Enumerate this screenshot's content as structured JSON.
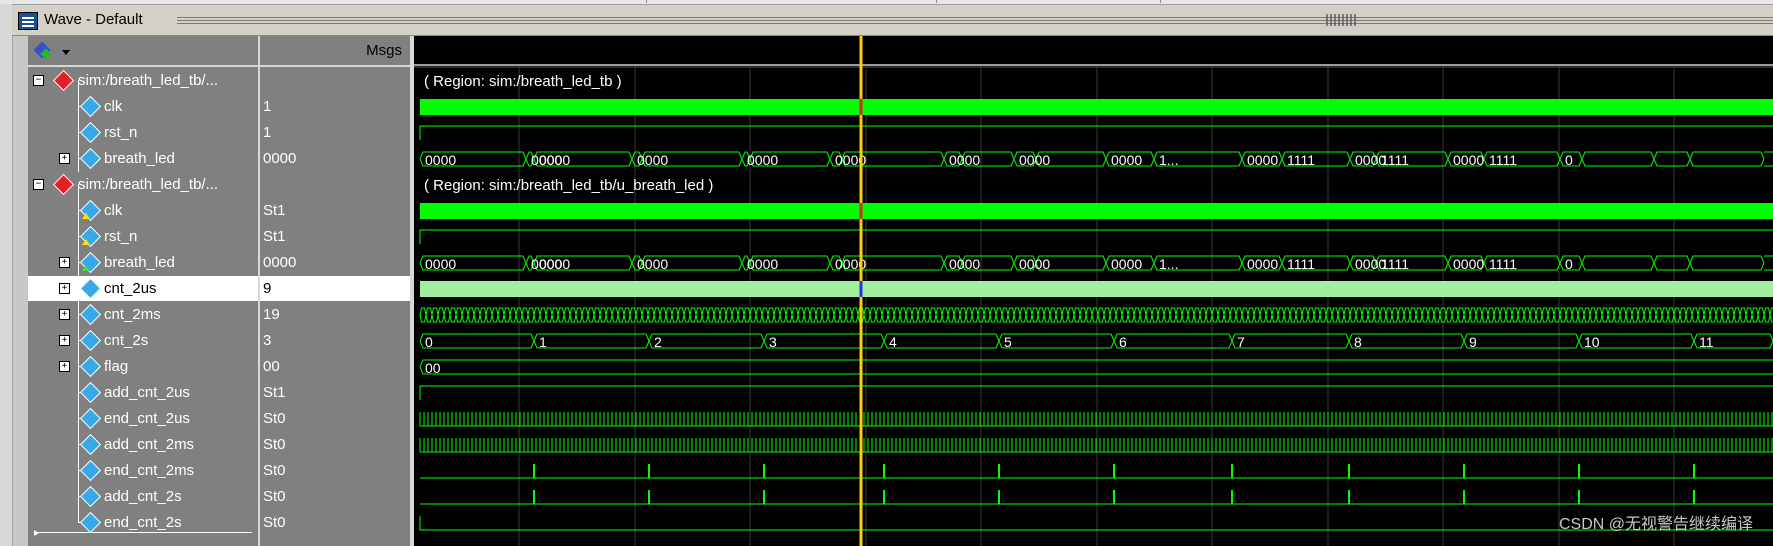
{
  "window": {
    "title": "Wave - Default"
  },
  "header": {
    "msgs_label": "Msgs",
    "tool_icon": "wave-format-icon"
  },
  "rows": [
    {
      "name": "sim:/breath_led_tb/...",
      "value": "",
      "kind": "group",
      "expand": "−",
      "region": "( Region: sim:/breath_led_tb )"
    },
    {
      "name": "clk",
      "value": "1",
      "kind": "signal"
    },
    {
      "name": "rst_n",
      "value": "1",
      "kind": "signal"
    },
    {
      "name": "breath_led",
      "value": "0000",
      "kind": "bus",
      "expand": "+"
    },
    {
      "name": "sim:/breath_led_tb/...",
      "value": "",
      "kind": "group",
      "expand": "−",
      "region": "( Region: sim:/breath_led_tb/u_breath_led )"
    },
    {
      "name": "clk",
      "value": "St1",
      "kind": "signal",
      "arrow": "in"
    },
    {
      "name": "rst_n",
      "value": "St1",
      "kind": "signal",
      "arrow": "in"
    },
    {
      "name": "breath_led",
      "value": "0000",
      "kind": "bus",
      "expand": "+",
      "arrow": "out"
    },
    {
      "name": "cnt_2us",
      "value": "9",
      "kind": "bus",
      "expand": "+",
      "selected": true
    },
    {
      "name": "cnt_2ms",
      "value": "19",
      "kind": "bus",
      "expand": "+"
    },
    {
      "name": "cnt_2s",
      "value": "3",
      "kind": "bus",
      "expand": "+"
    },
    {
      "name": "flag",
      "value": "00",
      "kind": "bus",
      "expand": "+"
    },
    {
      "name": "add_cnt_2us",
      "value": "St1",
      "kind": "signal"
    },
    {
      "name": "end_cnt_2us",
      "value": "St0",
      "kind": "signal"
    },
    {
      "name": "add_cnt_2ms",
      "value": "St0",
      "kind": "signal"
    },
    {
      "name": "end_cnt_2ms",
      "value": "St0",
      "kind": "signal"
    },
    {
      "name": "add_cnt_2s",
      "value": "St0",
      "kind": "signal"
    },
    {
      "name": "end_cnt_2s",
      "value": "St0",
      "kind": "signal"
    }
  ],
  "waves": {
    "breath_led_segments": [
      "0000",
      "0000",
      "0000",
      "0000",
      "",
      "0000",
      "",
      "0000",
      "",
      "0000",
      "",
      "0000",
      "",
      "0000",
      "1...",
      "0000",
      "1111",
      "0000",
      "1111",
      "0000",
      "1111",
      "0"
    ],
    "cnt_2s_segments": [
      "0",
      "1",
      "2",
      "3",
      "4",
      "5",
      "6",
      "7",
      "8",
      "9",
      "10",
      "11"
    ],
    "flag_segments": [
      "00"
    ]
  },
  "colors": {
    "wave": "#00ff00",
    "wave_dim": "#40c040",
    "cursor": "#ffd000",
    "grid": "#3a3a3a"
  },
  "watermark": "CSDN @无视警告继续编译"
}
